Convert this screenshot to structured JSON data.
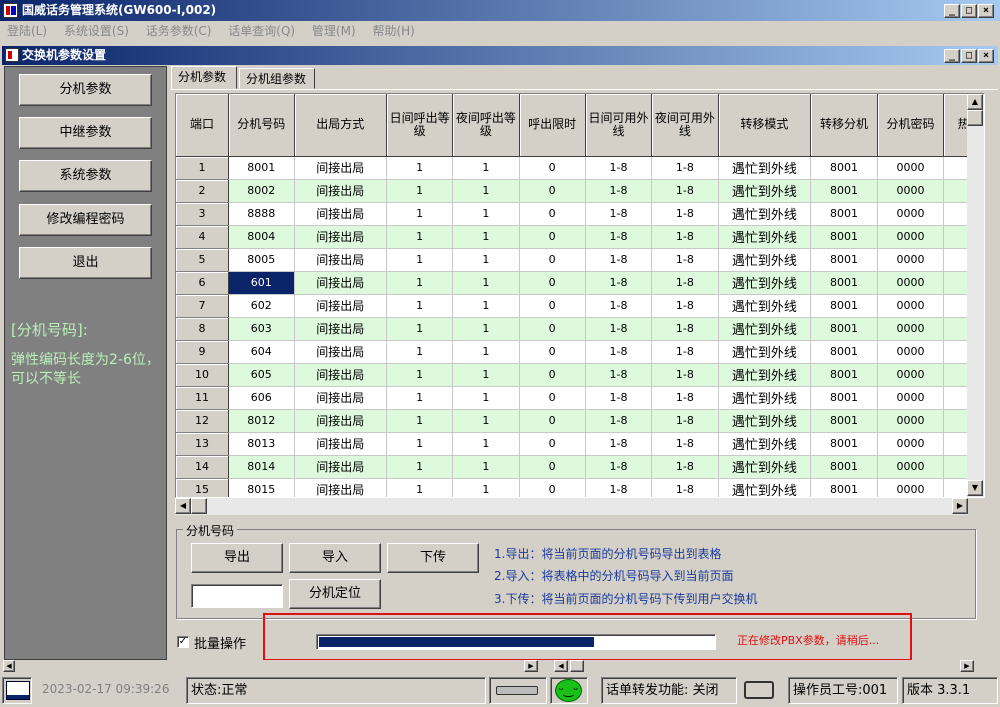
{
  "app": {
    "title": "国威话务管理系统(GW600-I,002)"
  },
  "menu": [
    "登陆(L)",
    "系统设置(S)",
    "话务参数(C)",
    "话单查询(Q)",
    "管理(M)",
    "帮助(H)"
  ],
  "child_window": {
    "title": "交换机参数设置"
  },
  "nav": {
    "items": [
      "分机参数",
      "中继参数",
      "系统参数",
      "修改编程密码",
      "退出"
    ]
  },
  "hint": {
    "title": "[分机号码]:",
    "body": "弹性编码长度为2-6位，可以不等长"
  },
  "tabs": [
    "分机参数",
    "分机组参数"
  ],
  "table": {
    "headers": [
      "端口",
      "分机号码",
      "出局方式",
      "日间呼出等级",
      "夜间呼出等级",
      "呼出限时",
      "日间可用外线",
      "夜间可用外线",
      "转移模式",
      "转移分机",
      "分机密码",
      "热"
    ],
    "rows": [
      [
        "1",
        "8001",
        "间接出局",
        "1",
        "1",
        "0",
        "1-8",
        "1-8",
        "遇忙到外线",
        "8001",
        "0000"
      ],
      [
        "2",
        "8002",
        "间接出局",
        "1",
        "1",
        "0",
        "1-8",
        "1-8",
        "遇忙到外线",
        "8001",
        "0000"
      ],
      [
        "3",
        "8888",
        "间接出局",
        "1",
        "1",
        "0",
        "1-8",
        "1-8",
        "遇忙到外线",
        "8001",
        "0000"
      ],
      [
        "4",
        "8004",
        "间接出局",
        "1",
        "1",
        "0",
        "1-8",
        "1-8",
        "遇忙到外线",
        "8001",
        "0000"
      ],
      [
        "5",
        "8005",
        "间接出局",
        "1",
        "1",
        "0",
        "1-8",
        "1-8",
        "遇忙到外线",
        "8001",
        "0000"
      ],
      [
        "6",
        "601",
        "间接出局",
        "1",
        "1",
        "0",
        "1-8",
        "1-8",
        "遇忙到外线",
        "8001",
        "0000"
      ],
      [
        "7",
        "602",
        "间接出局",
        "1",
        "1",
        "0",
        "1-8",
        "1-8",
        "遇忙到外线",
        "8001",
        "0000"
      ],
      [
        "8",
        "603",
        "间接出局",
        "1",
        "1",
        "0",
        "1-8",
        "1-8",
        "遇忙到外线",
        "8001",
        "0000"
      ],
      [
        "9",
        "604",
        "间接出局",
        "1",
        "1",
        "0",
        "1-8",
        "1-8",
        "遇忙到外线",
        "8001",
        "0000"
      ],
      [
        "10",
        "605",
        "间接出局",
        "1",
        "1",
        "0",
        "1-8",
        "1-8",
        "遇忙到外线",
        "8001",
        "0000"
      ],
      [
        "11",
        "606",
        "间接出局",
        "1",
        "1",
        "0",
        "1-8",
        "1-8",
        "遇忙到外线",
        "8001",
        "0000"
      ],
      [
        "12",
        "8012",
        "间接出局",
        "1",
        "1",
        "0",
        "1-8",
        "1-8",
        "遇忙到外线",
        "8001",
        "0000"
      ],
      [
        "13",
        "8013",
        "间接出局",
        "1",
        "1",
        "0",
        "1-8",
        "1-8",
        "遇忙到外线",
        "8001",
        "0000"
      ],
      [
        "14",
        "8014",
        "间接出局",
        "1",
        "1",
        "0",
        "1-8",
        "1-8",
        "遇忙到外线",
        "8001",
        "0000"
      ],
      [
        "15",
        "8015",
        "间接出局",
        "1",
        "1",
        "0",
        "1-8",
        "1-8",
        "遇忙到外线",
        "8001",
        "0000"
      ]
    ],
    "selected_row": 6,
    "alt_color": "#ddfadd"
  },
  "group": {
    "label": "分机号码",
    "export_label": "导出",
    "import_label": "导入",
    "download_label": "下传",
    "locate_label": "分机定位",
    "locate_value": "",
    "info": [
      "1.导出：将当前页面的分机号码导出到表格",
      "2.导入：将表格中的分机号码导入到当前页面",
      "3.下传：将当前页面的分机号码下传到用户交换机"
    ]
  },
  "batch": {
    "label": "批量操作",
    "checked": true,
    "progress": 0.7,
    "status_text": "正在修改PBX参数，请稍后..."
  },
  "statusbar": {
    "datetime": "2023-02-17 09:39:26",
    "state": "状态:正常",
    "forward": "话单转发功能: 关闭",
    "operator": "操作员工号:001",
    "version": "版本 3.3.1"
  },
  "colors": {
    "titlebar": "#0a246a",
    "highlight_red": "#e01010",
    "hint_green": "#b8f0b8",
    "info_blue": "#1a3a9a"
  }
}
